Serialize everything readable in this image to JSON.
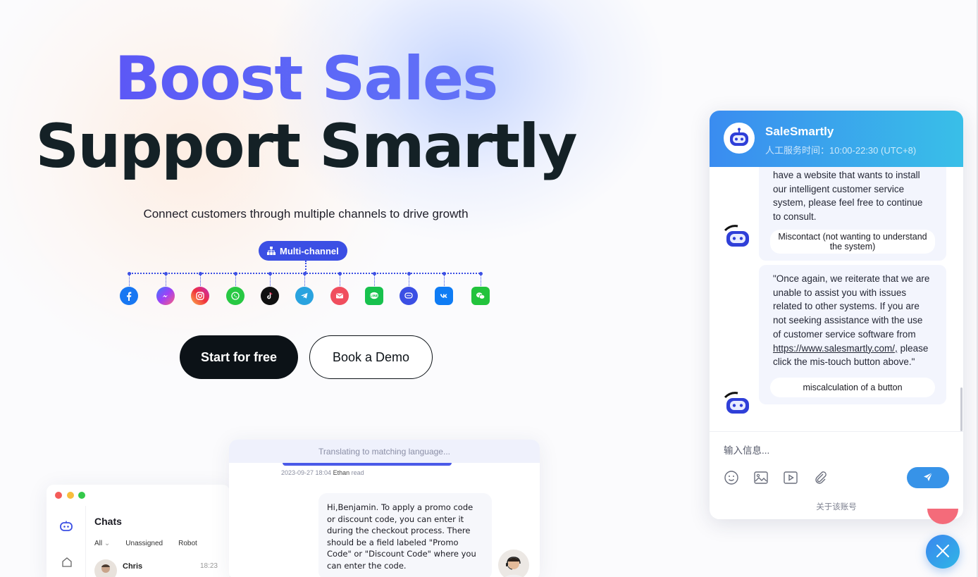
{
  "hero": {
    "title_line1": "Boost Sales",
    "title_line2": "Support Smartly",
    "subtitle": "Connect customers through multiple channels to drive growth",
    "badge": "Multi-channel",
    "channels": [
      "facebook-icon",
      "messenger-icon",
      "instagram-icon",
      "whatsapp-icon",
      "tiktok-icon",
      "telegram-icon",
      "email-icon",
      "line-icon",
      "chat-icon",
      "vk-icon",
      "wechat-icon"
    ],
    "cta_primary": "Start for free",
    "cta_secondary": "Book a Demo"
  },
  "preview": {
    "chats_title": "Chats",
    "tabs": [
      "All",
      "Unassigned",
      "Robot"
    ],
    "contact_name": "Chris",
    "contact_time": "18:23",
    "translating": "Translating to matching language...",
    "meta_time": "2023-09-27 18:04",
    "meta_user": "Ethan",
    "meta_status": "read",
    "agent_message": "Hi,Benjamin. To apply a promo code or discount code, you can enter it during the checkout process. There should be a field labeled \"Promo Code\" or \"Discount Code\" where you can enter the code."
  },
  "widget": {
    "title": "SaleSmartly",
    "hours": "人工服务时间：10:00-22:30 (UTC+8)",
    "msg1_text": "have a website that wants to install our intelligent customer service system, please feel free to continue to consult.",
    "msg1_button": "Miscontact (not wanting to understand the system)",
    "msg2_text_a": "\"Once again, we reiterate that we are unable to assist you with issues related to other systems. If you are not seeking assistance with the use of customer service software from",
    "msg2_link": "https://www.salesmartly.com/,",
    "msg2_text_b": "please click the mis-touch button above.\"",
    "msg2_button": "miscalculation of a button",
    "input_placeholder": "输入信息...",
    "about": "关于该账号"
  },
  "colors": {
    "accent": "#3b4fe4",
    "widget_gradient_start": "#3a8cf0",
    "widget_gradient_end": "#39bfe8",
    "dark_button": "#0c1217"
  }
}
